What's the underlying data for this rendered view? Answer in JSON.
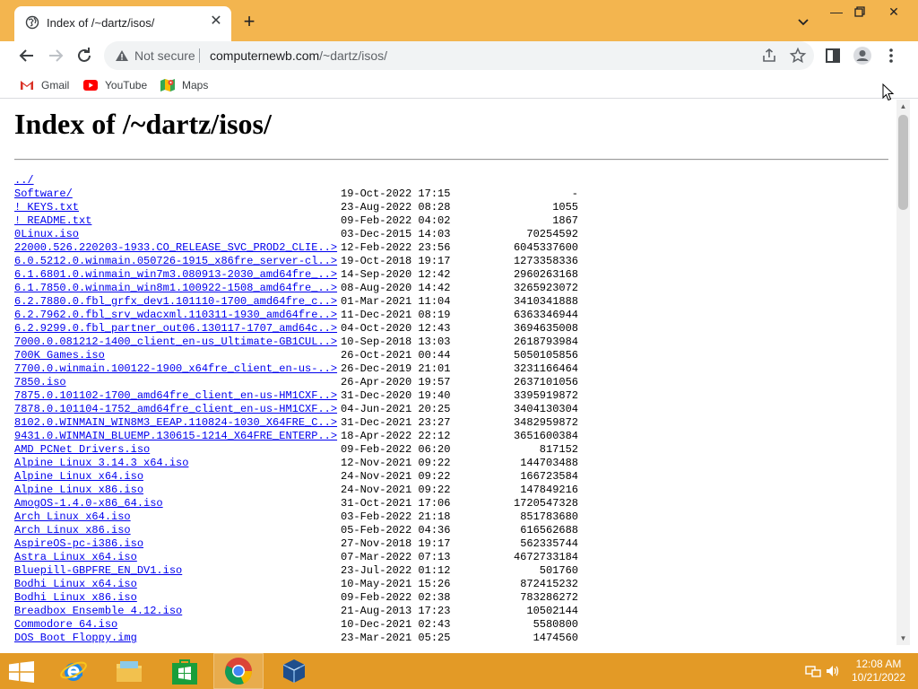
{
  "browser": {
    "tab_title": "Index of /~dartz/isos/",
    "security_label": "Not secure",
    "url_host": "computernewb.com",
    "url_path": "/~dartz/isos/"
  },
  "bookmarks": [
    {
      "label": "Gmail"
    },
    {
      "label": "YouTube"
    },
    {
      "label": "Maps"
    }
  ],
  "page": {
    "heading": "Index of /~dartz/isos/",
    "parent_link": "../",
    "entries": [
      {
        "name": "Software/",
        "date": "19-Oct-2022 17:15",
        "size": "-"
      },
      {
        "name": "! KEYS.txt",
        "date": "23-Aug-2022 08:28",
        "size": "1055"
      },
      {
        "name": "! README.txt",
        "date": "09-Feb-2022 04:02",
        "size": "1867"
      },
      {
        "name": "0Linux.iso",
        "date": "03-Dec-2015 14:03",
        "size": "70254592"
      },
      {
        "name": "22000.526.220203-1933.CO_RELEASE_SVC_PROD2_CLIE..>",
        "date": "12-Feb-2022 23:56",
        "size": "6045337600"
      },
      {
        "name": "6.0.5212.0.winmain.050726-1915_x86fre_server-cl..>",
        "date": "19-Oct-2018 19:17",
        "size": "1273358336"
      },
      {
        "name": "6.1.6801.0.winmain_win7m3.080913-2030_amd64fre_..>",
        "date": "14-Sep-2020 12:42",
        "size": "2960263168"
      },
      {
        "name": "6.1.7850.0.winmain_win8m1.100922-1508_amd64fre_..>",
        "date": "08-Aug-2020 14:42",
        "size": "3265923072"
      },
      {
        "name": "6.2.7880.0.fbl_grfx_dev1.101110-1700_amd64fre_c..>",
        "date": "01-Mar-2021 11:04",
        "size": "3410341888"
      },
      {
        "name": "6.2.7962.0.fbl_srv_wdacxml.110311-1930_amd64fre..>",
        "date": "11-Dec-2021 08:19",
        "size": "6363346944"
      },
      {
        "name": "6.2.9299.0.fbl_partner_out06.130117-1707_amd64c..>",
        "date": "04-Oct-2020 12:43",
        "size": "3694635008"
      },
      {
        "name": "7000.0.081212-1400_client_en-us_Ultimate-GB1CUL..>",
        "date": "10-Sep-2018 13:03",
        "size": "2618793984"
      },
      {
        "name": "700K Games.iso",
        "date": "26-Oct-2021 00:44",
        "size": "5050105856"
      },
      {
        "name": "7700.0.winmain.100122-1900_x64fre_client_en-us-..>",
        "date": "26-Dec-2019 21:01",
        "size": "3231166464"
      },
      {
        "name": "7850.iso",
        "date": "26-Apr-2020 19:57",
        "size": "2637101056"
      },
      {
        "name": "7875.0.101102-1700_amd64fre_client_en-us-HM1CXF..>",
        "date": "31-Dec-2020 19:40",
        "size": "3395919872"
      },
      {
        "name": "7878.0.101104-1752_amd64fre_client_en-us-HM1CXF..>",
        "date": "04-Jun-2021 20:25",
        "size": "3404130304"
      },
      {
        "name": "8102.0.WINMAIN_WIN8M3_EEAP.110824-1030_X64FRE_C..>",
        "date": "31-Dec-2021 23:27",
        "size": "3482959872"
      },
      {
        "name": "9431.0.WINMAIN_BLUEMP.130615-1214_X64FRE_ENTERP..>",
        "date": "18-Apr-2022 22:12",
        "size": "3651600384"
      },
      {
        "name": "AMD PCNet Drivers.iso",
        "date": "09-Feb-2022 06:20",
        "size": "817152"
      },
      {
        "name": "Alpine Linux 3.14.3 x64.iso",
        "date": "12-Nov-2021 09:22",
        "size": "144703488"
      },
      {
        "name": "Alpine Linux x64.iso",
        "date": "24-Nov-2021 09:22",
        "size": "166723584"
      },
      {
        "name": "Alpine Linux x86.iso",
        "date": "24-Nov-2021 09:22",
        "size": "147849216"
      },
      {
        "name": "AmogOS-1.4.0-x86_64.iso",
        "date": "31-Oct-2021 17:06",
        "size": "1720547328"
      },
      {
        "name": "Arch Linux x64.iso",
        "date": "03-Feb-2022 21:18",
        "size": "851783680"
      },
      {
        "name": "Arch Linux x86.iso",
        "date": "05-Feb-2022 04:36",
        "size": "616562688"
      },
      {
        "name": "AspireOS-pc-i386.iso",
        "date": "27-Nov-2018 19:17",
        "size": "562335744"
      },
      {
        "name": "Astra Linux x64.iso",
        "date": "07-Mar-2022 07:13",
        "size": "4672733184"
      },
      {
        "name": "Bluepill-GBPFRE_EN_DV1.iso",
        "date": "23-Jul-2022 01:12",
        "size": "501760"
      },
      {
        "name": "Bodhi Linux x64.iso",
        "date": "10-May-2021 15:26",
        "size": "872415232"
      },
      {
        "name": "Bodhi Linux x86.iso",
        "date": "09-Feb-2022 02:38",
        "size": "783286272"
      },
      {
        "name": "Breadbox Ensemble 4.12.iso",
        "date": "21-Aug-2013 17:23",
        "size": "10502144"
      },
      {
        "name": "Commodore 64.iso",
        "date": "10-Dec-2021 02:43",
        "size": "5580800"
      },
      {
        "name": "DOS Boot Floppy.img",
        "date": "23-Mar-2021 05:25",
        "size": "1474560"
      }
    ]
  },
  "taskbar": {
    "apps": [
      {
        "name": "internet-explorer"
      },
      {
        "name": "file-explorer"
      },
      {
        "name": "store"
      },
      {
        "name": "google-chrome"
      },
      {
        "name": "virtualbox"
      }
    ],
    "time": "12:08 AM",
    "date": "10/21/2022"
  },
  "colors": {
    "titlebar": "#f3b54f",
    "taskbar": "#e39a26",
    "link": "#0000ee"
  }
}
